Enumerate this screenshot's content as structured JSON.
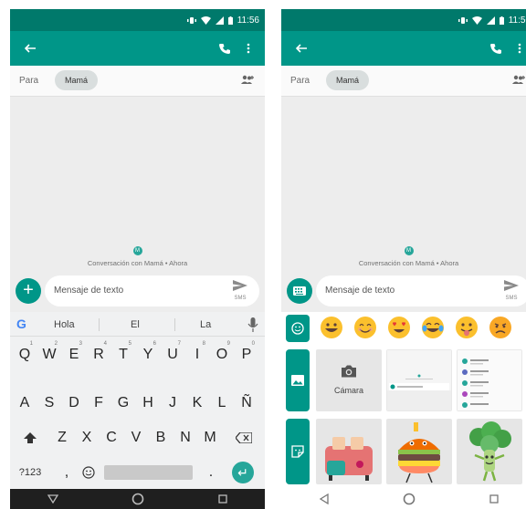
{
  "status_bar": {
    "time": "11:56"
  },
  "recipient": {
    "to_label": "Para",
    "chip": "Mamá"
  },
  "conversation": {
    "avatar_initial": "M",
    "info": "Conversación con Mamá • Ahora"
  },
  "composer": {
    "placeholder": "Mensaje de texto",
    "send_type": "SMS"
  },
  "keyboard": {
    "suggestions": [
      "Hola",
      "El",
      "La"
    ],
    "row1": [
      "Q",
      "W",
      "E",
      "R",
      "T",
      "Y",
      "U",
      "I",
      "O",
      "P"
    ],
    "row1_hints": [
      "1",
      "2",
      "3",
      "4",
      "5",
      "6",
      "7",
      "8",
      "9",
      "0"
    ],
    "row2": [
      "A",
      "S",
      "D",
      "F",
      "G",
      "H",
      "J",
      "K",
      "L",
      "Ñ"
    ],
    "row3": [
      "Z",
      "X",
      "C",
      "V",
      "B",
      "N",
      "M"
    ],
    "symbols_key": "?123",
    "comma": ",",
    "period": "."
  },
  "media_panel": {
    "camera_label": "Cámara"
  },
  "colors": {
    "primary": "#009688",
    "primary_dark": "#00796b",
    "accent": "#26a69a"
  },
  "icons": {
    "status": [
      "vibrate-icon",
      "wifi-icon",
      "signal-icon",
      "battery-icon"
    ],
    "appbar": [
      "back-arrow-icon",
      "phone-icon",
      "more-vert-icon"
    ],
    "emoji_tabs": [
      "emoji-tab-icon",
      "gallery-tab-icon",
      "sticker-tab-icon"
    ],
    "emojis": [
      "grinning-face",
      "smiling-face",
      "heart-eyes-face",
      "tears-of-joy-face",
      "tongue-out-face",
      "sad-face"
    ],
    "stickers": [
      "toaster-sticker",
      "burger-sticker",
      "broccoli-sticker"
    ]
  }
}
